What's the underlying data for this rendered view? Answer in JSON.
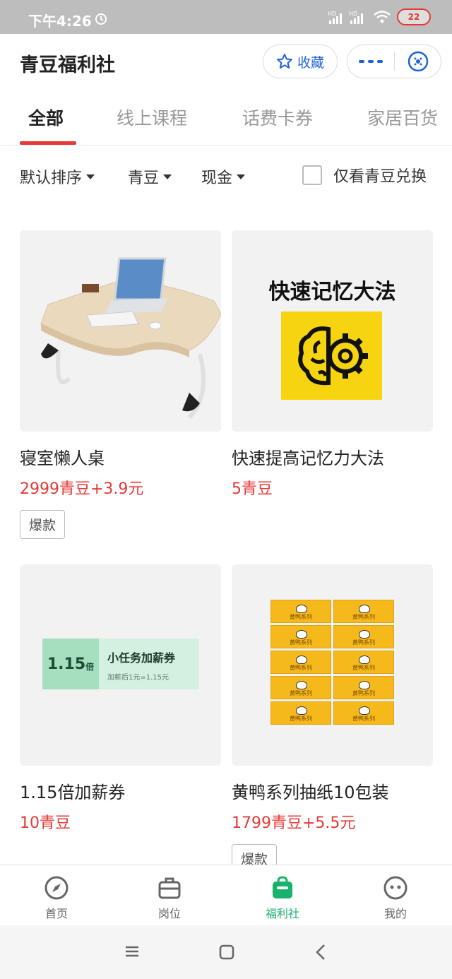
{
  "status_bar": {
    "time": "下午4:26",
    "signal_label": "HD",
    "battery": "22"
  },
  "header": {
    "title": "青豆福利社",
    "favorite_label": "收藏"
  },
  "tabs": [
    {
      "label": "全部"
    },
    {
      "label": "线上课程"
    },
    {
      "label": "话费卡券"
    },
    {
      "label": "家居百货"
    }
  ],
  "filters": {
    "sort": "默认排序",
    "beans": "青豆",
    "cash": "现金",
    "only_beans": "仅看青豆兑换"
  },
  "products": [
    {
      "title": "寝室懒人桌",
      "price": "2999青豆+3.9元",
      "badge": "爆款"
    },
    {
      "title": "快速提高记忆力大法",
      "price": "5青豆",
      "badge": "",
      "image_text": "快速记忆大法"
    },
    {
      "title": "1.15倍加薪券",
      "price": "10青豆",
      "badge": "",
      "coupon_value": "1.15",
      "coupon_unit": "倍",
      "coupon_name": "小任务加薪券",
      "coupon_note": "加薪后1元=1.15元"
    },
    {
      "title": "黄鸭系列抽纸10包装",
      "price": "1799青豆+5.5元",
      "badge": "爆款",
      "pack_label": "黄鸭系列"
    }
  ],
  "bottom_nav": [
    {
      "label": "首页",
      "icon": "compass-icon"
    },
    {
      "label": "岗位",
      "icon": "briefcase-icon"
    },
    {
      "label": "福利社",
      "icon": "gift-bag-icon",
      "active": true
    },
    {
      "label": "我的",
      "icon": "face-icon"
    }
  ],
  "colors": {
    "accent": "#e53935",
    "nav_active": "#18b26b",
    "link_blue": "#1e63d6"
  }
}
